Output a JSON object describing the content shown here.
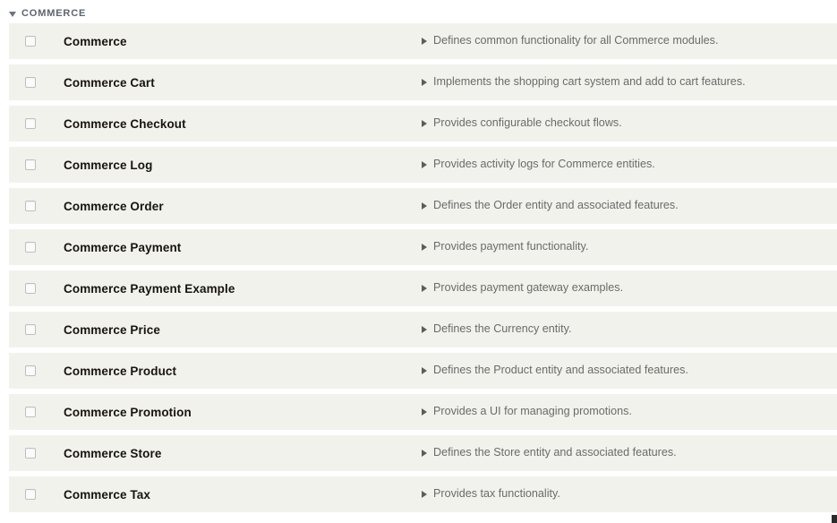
{
  "group": {
    "label": "COMMERCE",
    "expanded": true,
    "caret_icon": "caret-down-icon"
  },
  "row_icons": {
    "checkbox": "checkbox-unchecked-icon",
    "description_toggle": "caret-right-icon"
  },
  "colors": {
    "row_background": "#f2f2ed",
    "page_background": "#ffffff",
    "module_name_text": "#17140f",
    "description_text": "#6a6a68",
    "group_header_text": "#5c6472",
    "checkbox_border": "#bfbfbf"
  },
  "modules": [
    {
      "name": "Commerce",
      "description": "Defines common functionality for all Commerce modules.",
      "checked": false
    },
    {
      "name": "Commerce Cart",
      "description": "Implements the shopping cart system and add to cart features.",
      "checked": false
    },
    {
      "name": "Commerce Checkout",
      "description": "Provides configurable checkout flows.",
      "checked": false
    },
    {
      "name": "Commerce Log",
      "description": "Provides activity logs for Commerce entities.",
      "checked": false
    },
    {
      "name": "Commerce Order",
      "description": "Defines the Order entity and associated features.",
      "checked": false
    },
    {
      "name": "Commerce Payment",
      "description": "Provides payment functionality.",
      "checked": false
    },
    {
      "name": "Commerce Payment Example",
      "description": "Provides payment gateway examples.",
      "checked": false
    },
    {
      "name": "Commerce Price",
      "description": "Defines the Currency entity.",
      "checked": false
    },
    {
      "name": "Commerce Product",
      "description": "Defines the Product entity and associated features.",
      "checked": false
    },
    {
      "name": "Commerce Promotion",
      "description": "Provides a UI for managing promotions.",
      "checked": false
    },
    {
      "name": "Commerce Store",
      "description": "Defines the Store entity and associated features.",
      "checked": false
    },
    {
      "name": "Commerce Tax",
      "description": "Provides tax functionality.",
      "checked": false
    }
  ]
}
